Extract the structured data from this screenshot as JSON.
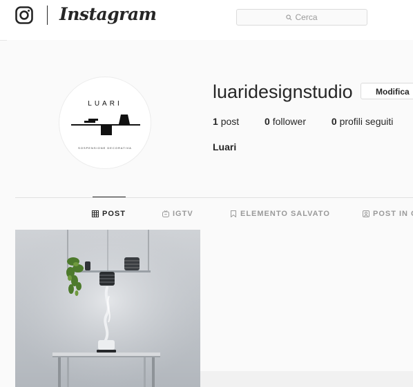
{
  "brand": {
    "wordmark": "Instagram",
    "logo_icon": "instagram-camera-icon"
  },
  "search": {
    "placeholder": "Cerca",
    "icon": "search-icon"
  },
  "profile": {
    "username": "luaridesignstudio",
    "edit_label": "Modifica",
    "full_name": "Luari",
    "avatar": {
      "brand_text": "LUARI",
      "tagline": "SOSPENSIONE DECORATIVA"
    },
    "stats": [
      {
        "count": "1",
        "label": "post"
      },
      {
        "count": "0",
        "label": "follower"
      },
      {
        "count": "0",
        "label": "profili seguiti"
      }
    ]
  },
  "tabs": [
    {
      "label": "POST",
      "icon": "grid-icon",
      "active": true
    },
    {
      "label": "IGTV",
      "icon": "igtv-icon",
      "active": false
    },
    {
      "label": "ELEMENTO SALVATO",
      "icon": "bookmark-icon",
      "active": false
    },
    {
      "label": "POST IN C",
      "icon": "tagged-icon",
      "active": false
    }
  ],
  "colors": {
    "text": "#262626",
    "muted": "#999999",
    "border": "#dbdbdb",
    "background": "#fafafa"
  }
}
